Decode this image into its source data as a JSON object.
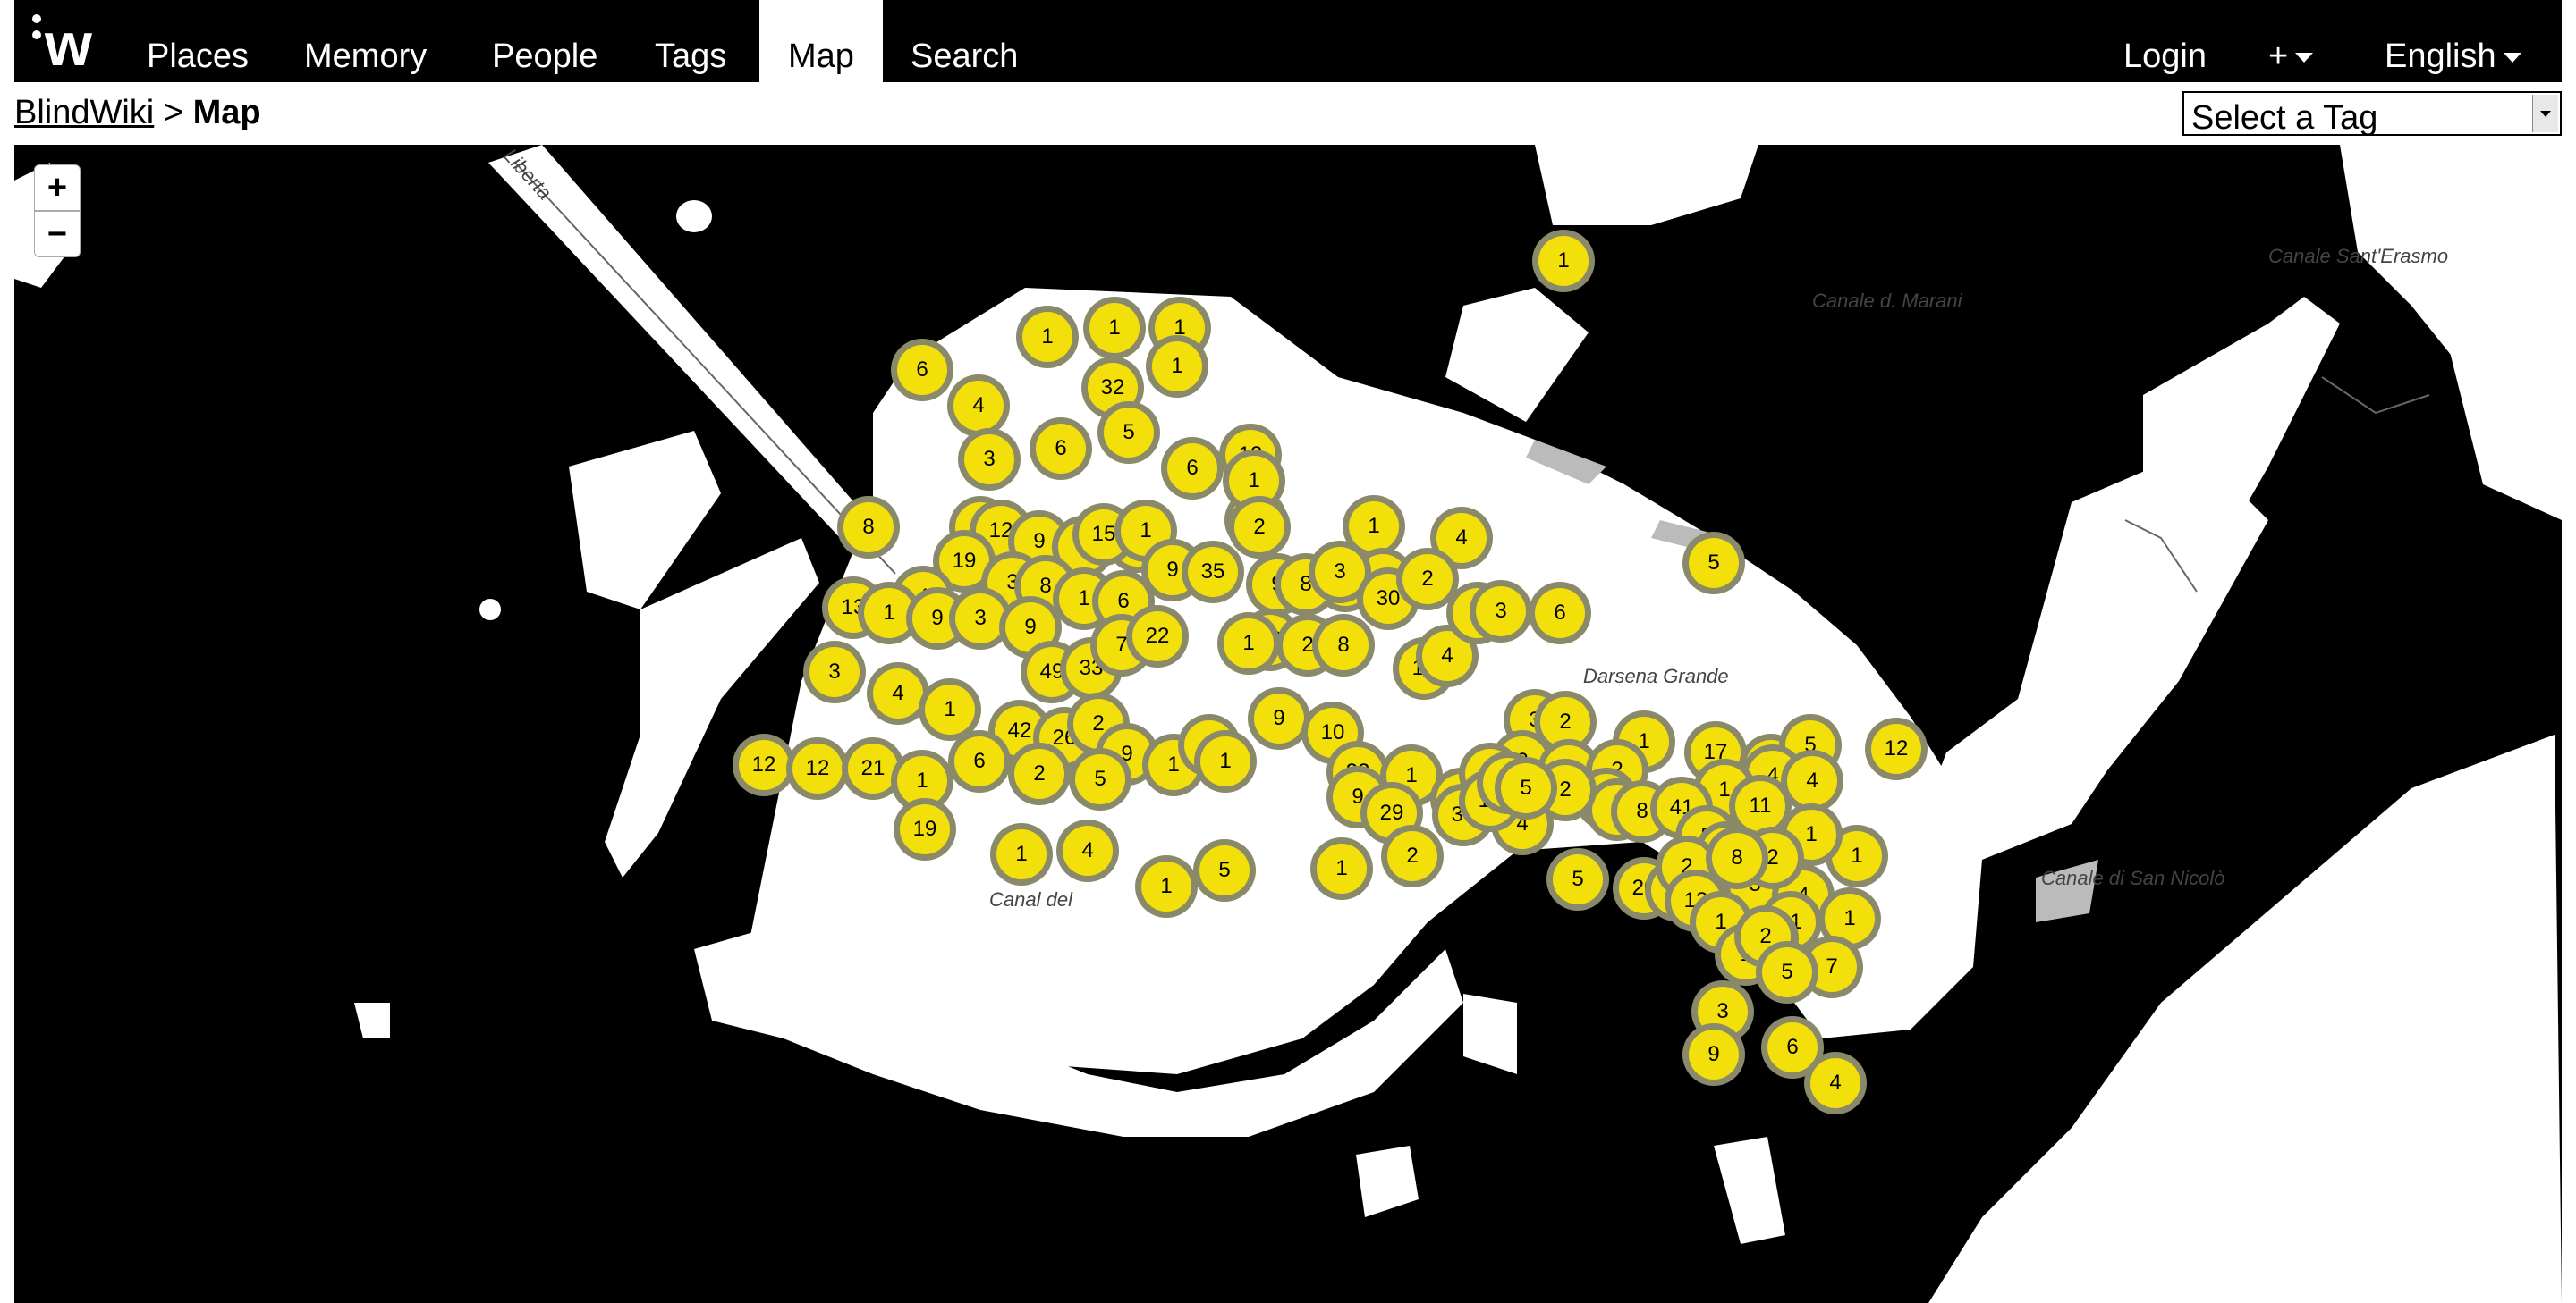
{
  "nav": {
    "logo": "w",
    "items": [
      {
        "label": "Places",
        "active": false
      },
      {
        "label": "Memory",
        "active": false
      },
      {
        "label": "People",
        "active": false
      },
      {
        "label": "Tags",
        "active": false
      },
      {
        "label": "Map",
        "active": true
      },
      {
        "label": "Search",
        "active": false
      }
    ],
    "login": "Login",
    "add": "+",
    "language": "English"
  },
  "breadcrumb": {
    "home": "BlindWiki",
    "separator": ">",
    "current": "Map"
  },
  "tag_select": {
    "selected": "Select a Tag"
  },
  "map": {
    "zoom_in": "+",
    "zoom_out": "−",
    "place_labels": {
      "marani": "Canale d. Marani",
      "erasmo": "Canale Sant'Erasmo",
      "darsena": "Darsena Grande",
      "nicolo": "Canale di San Nicolò",
      "canal": "Canal del",
      "liberta": "Liberta"
    },
    "colors": {
      "water": "#000000",
      "land": "#ffffff",
      "cluster": "#f3e00b",
      "cluster_ring": "#8a8a6a"
    }
  },
  "clusters": [
    "1",
    "1",
    "1",
    "1",
    "6",
    "4",
    "32",
    "1",
    "3",
    "6",
    "5",
    "6",
    "12",
    "6",
    "1",
    "2",
    "1",
    "4",
    "4",
    "2",
    "8",
    "5",
    "12",
    "9",
    "4",
    "3",
    "15",
    "1",
    "9",
    "35",
    "9",
    "8",
    "3",
    "30",
    "2",
    "19",
    "3",
    "8",
    "1",
    "6",
    "13",
    "4",
    "1",
    "9",
    "3",
    "9",
    "20",
    "2",
    "8",
    "12",
    "4",
    "1",
    "3",
    "6",
    "49",
    "33",
    "7",
    "22",
    "1",
    "5",
    "3",
    "4",
    "1",
    "42",
    "26",
    "2",
    "9",
    "9",
    "10",
    "3",
    "2",
    "1",
    "12",
    "12",
    "12",
    "21",
    "1",
    "6",
    "2",
    "5",
    "1",
    "1",
    "1",
    "22",
    "1",
    "4",
    "2",
    "3",
    "2",
    "17",
    "8",
    "5",
    "4",
    "1",
    "4",
    "4",
    "1",
    "9",
    "29",
    "2",
    "6",
    "2",
    "4",
    "8",
    "41",
    "5",
    "11",
    "1",
    "1",
    "19",
    "1",
    "4",
    "1",
    "5",
    "1",
    "2",
    "30",
    "10",
    "8",
    "5",
    "5",
    "20",
    "7",
    "3",
    "4",
    "2",
    "4",
    "2",
    "8",
    "13",
    "1",
    "11",
    "19",
    "1",
    "1",
    "2",
    "7",
    "5",
    "3",
    "6",
    "9",
    "4"
  ]
}
